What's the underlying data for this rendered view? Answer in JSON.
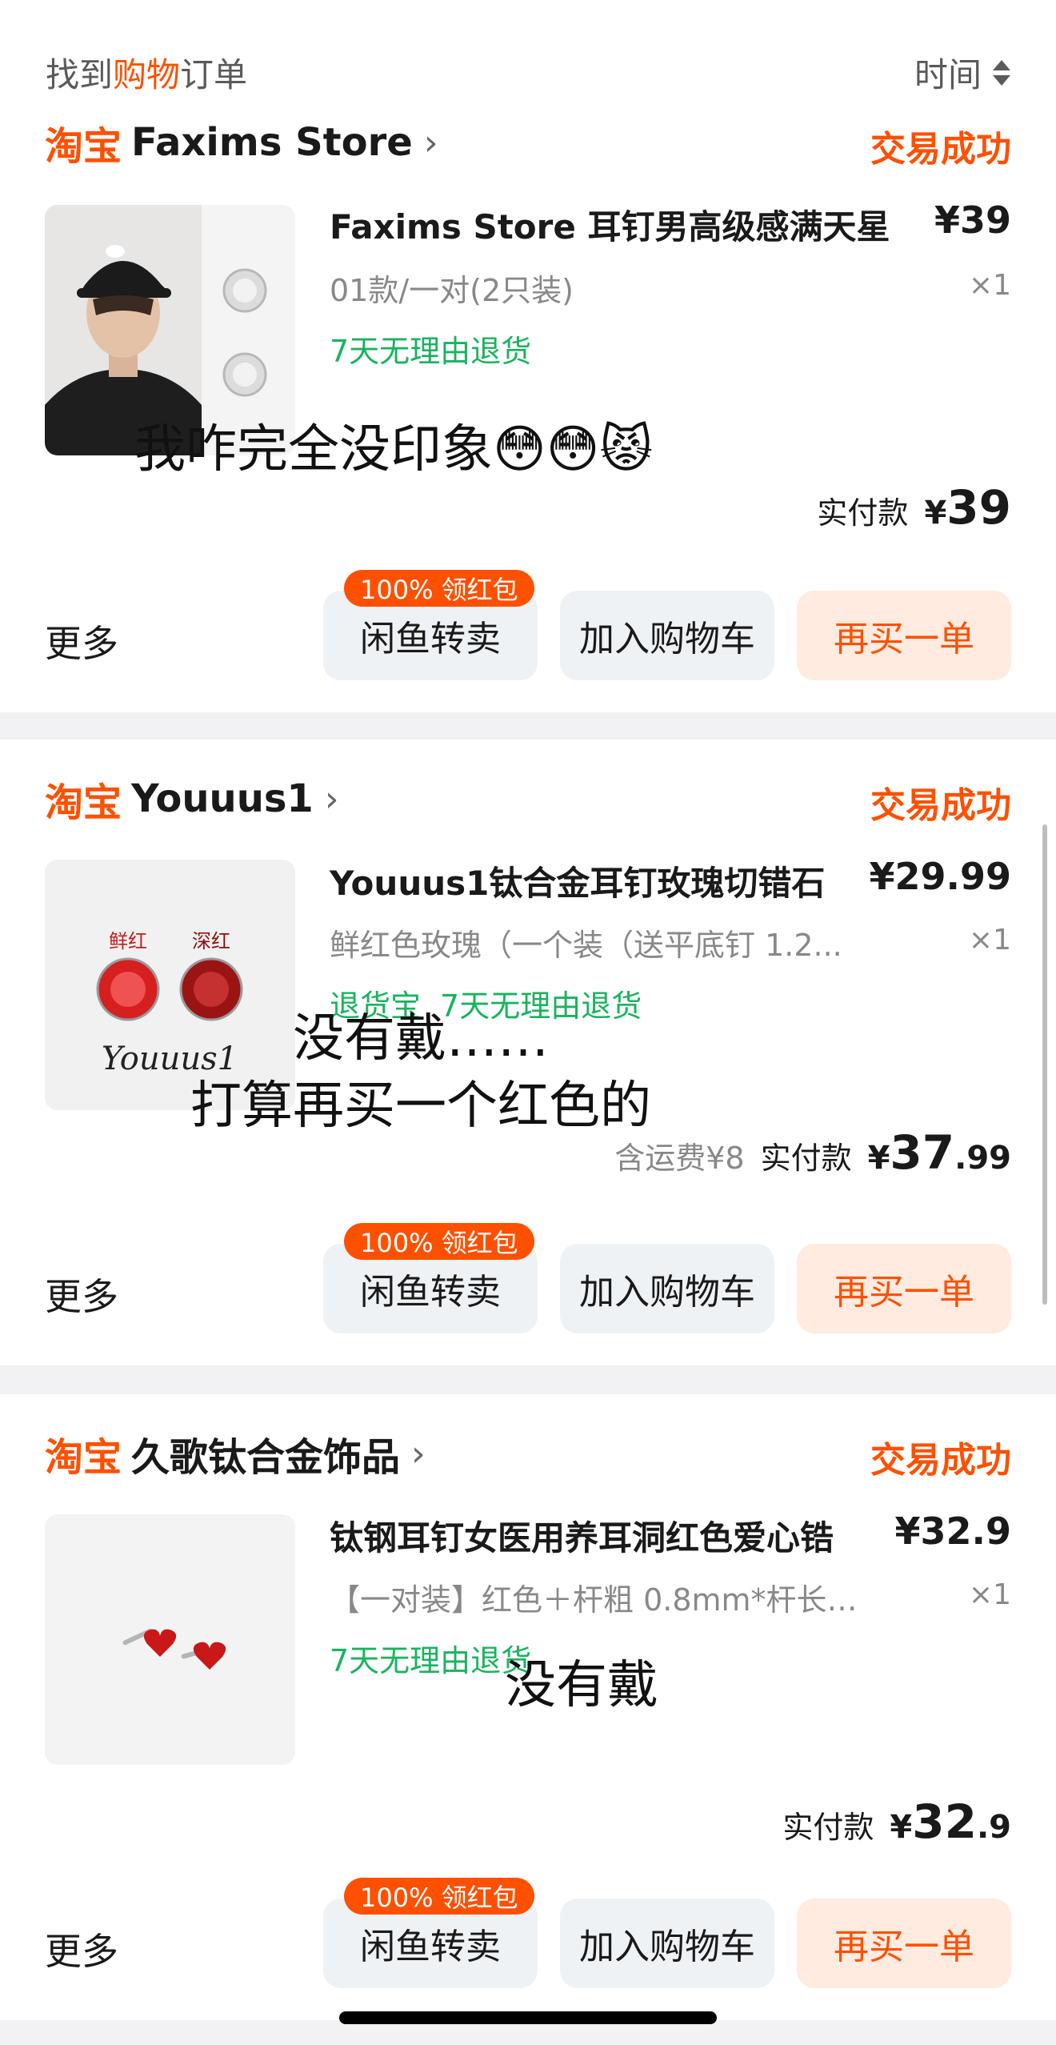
{
  "header": {
    "title_pre": "找到",
    "title_hl": "购物",
    "title_post": "订单",
    "sort_label": "时间"
  },
  "orders": [
    {
      "platform": "淘宝",
      "shop": "Faxims Store",
      "status": "交易成功",
      "title": "Faxims Store 耳钉男高级感满天星",
      "price": "¥39",
      "spec": "01款/一对(2只装)",
      "qty": "×1",
      "tags": [
        "7天无理由退货"
      ],
      "overlay": [
        "我咋完全没印象😳😳😾"
      ],
      "shipping": "",
      "paid_label": "实付款",
      "paid_currency": "¥",
      "paid_int": "39",
      "paid_dec": "",
      "more": "更多",
      "badge": "100% 领红包",
      "btn_resell": "闲鱼转卖",
      "btn_cart": "加入购物车",
      "btn_rebuy": "再买一单"
    },
    {
      "platform": "淘宝",
      "shop": "Youuus1",
      "status": "交易成功",
      "title": "Youuus1钛合金耳钉玫瑰切错石",
      "price": "¥29.99",
      "spec": "鲜红色玫瑰（一个装（送平底钉 1.2...",
      "qty": "×1",
      "tags": [
        "退货宝",
        "7天无理由退货"
      ],
      "thumb_labels": [
        "鲜红",
        "深红"
      ],
      "thumb_brand": "Youuus1",
      "overlay": [
        "没有戴……",
        "打算再买一个红色的"
      ],
      "shipping": "含运费¥8",
      "paid_label": "实付款",
      "paid_currency": "¥",
      "paid_int": "37",
      "paid_dec": ".99",
      "more": "更多",
      "badge": "100% 领红包",
      "btn_resell": "闲鱼转卖",
      "btn_cart": "加入购物车",
      "btn_rebuy": "再买一单"
    },
    {
      "platform": "淘宝",
      "shop": "久歌钛合金饰品",
      "status": "交易成功",
      "title": "钛钢耳钉女医用养耳洞红色爱心锆",
      "price": "¥32.9",
      "spec": "【一对装】红色＋杆粗 0.8mm*杆长 6...",
      "qty": "×1",
      "tags": [
        "7天无理由退货"
      ],
      "overlay": [
        "没有戴"
      ],
      "shipping": "",
      "paid_label": "实付款",
      "paid_currency": "¥",
      "paid_int": "32",
      "paid_dec": ".9",
      "more": "更多",
      "badge": "100% 领红包",
      "btn_resell": "闲鱼转卖",
      "btn_cart": "加入购物车",
      "btn_rebuy": "再买一单"
    }
  ],
  "colors": {
    "brand": "#ff5000",
    "success": "#19b35e",
    "secondary_text": "#888888"
  }
}
